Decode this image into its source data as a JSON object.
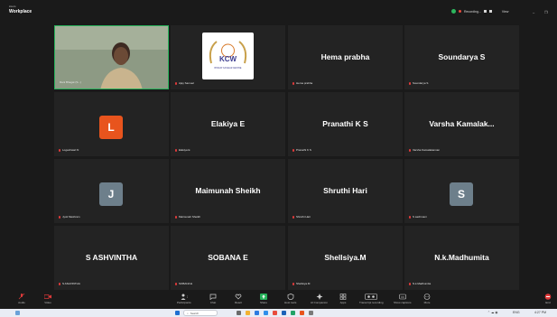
{
  "app": {
    "title": "Workplace",
    "subtitle": "zoom"
  },
  "recording": {
    "label": "Recording...",
    "view_label": "View"
  },
  "participants": [
    {
      "kind": "video",
      "caption": "Rani Bhagat (S...)"
    },
    {
      "kind": "logo",
      "caption": "Ajay Samuel",
      "logo_text": "KCW",
      "logo_sub": "BHAKAT KASIGAR CENTRE"
    },
    {
      "kind": "name",
      "name": "Hema prabha",
      "caption": "Hema prabha"
    },
    {
      "kind": "name",
      "name": "Soundarya S",
      "caption": "Soundarya S"
    },
    {
      "kind": "avatar",
      "letter": "L",
      "color": "#e8541d",
      "caption": "Logeshwari N"
    },
    {
      "kind": "name",
      "name": "Elakiya E",
      "caption": "Elakiya E"
    },
    {
      "kind": "name",
      "name": "Pranathi K S",
      "caption": "Pranathi K S"
    },
    {
      "kind": "name",
      "name": "Varsha Kamalak...",
      "caption": "Varsha Kamalakannan"
    },
    {
      "kind": "avatar",
      "letter": "J",
      "color": "#6d7f8b",
      "caption": "Jyoti Meshram"
    },
    {
      "kind": "name",
      "name": "Maimunah Sheikh",
      "caption": "Maimunah Sheikh"
    },
    {
      "kind": "name",
      "name": "Shruthi Hari",
      "caption": "Shruthi Hari"
    },
    {
      "kind": "avatar",
      "letter": "S",
      "color": "#6d7f8b",
      "caption": "S sachmani"
    },
    {
      "kind": "name",
      "name": "S ASHVINTHA",
      "caption": "S ASHVINTHA"
    },
    {
      "kind": "name",
      "name": "SOBANA E",
      "caption": "SOBANA E"
    },
    {
      "kind": "name",
      "name": "Shellsiya.M",
      "caption": "Shellsiya.M"
    },
    {
      "kind": "name",
      "name": "N.k.Madhumita",
      "caption": "N.k.Madhumita"
    }
  ],
  "toolbar": {
    "audio": "Audio",
    "video": "Video",
    "participants": "Participants",
    "participants_count": "16",
    "chat": "Chat",
    "react": "React",
    "share": "Share",
    "host_tools": "Host tools",
    "ai_companion": "AI Companion",
    "apps": "Apps",
    "transcript": "Transcript recording",
    "captions": "Show captions",
    "more": "More",
    "end": "End"
  },
  "taskbar": {
    "search_placeholder": "Search",
    "time": "4:27 PM",
    "lang": "ENG"
  },
  "colors": {
    "accent_green": "#27b35b",
    "muted_red": "#e03a3a",
    "tile_bg": "#232323",
    "bg": "#1a1a1a"
  }
}
